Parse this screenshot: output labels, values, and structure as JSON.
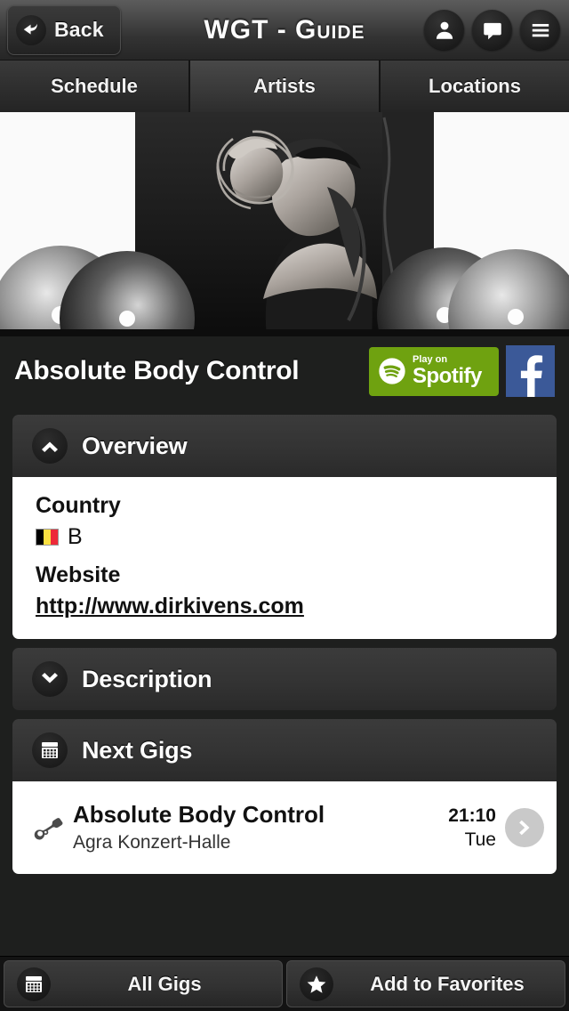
{
  "header": {
    "back_label": "Back",
    "title": "WGT - Guide",
    "icons": [
      "user-icon",
      "chat-icon",
      "menu-icon"
    ]
  },
  "tabs": [
    {
      "label": "Schedule",
      "active": false
    },
    {
      "label": "Artists",
      "active": true
    },
    {
      "label": "Locations",
      "active": false
    }
  ],
  "hero": {
    "alt": "Black and white band photo with vinyl records"
  },
  "artist": {
    "name": "Absolute Body Control",
    "spotify": {
      "line1": "Play on",
      "line2": "Spotify",
      "color": "#6fa210"
    },
    "facebook": {
      "glyph": "f",
      "color": "#3b5998"
    }
  },
  "overview": {
    "title": "Overview",
    "expanded": true,
    "country_label": "Country",
    "country_value": "B",
    "country_flag": [
      "#000000",
      "#fae042",
      "#ed2939"
    ],
    "website_label": "Website",
    "website_url": "http://www.dirkivens.com"
  },
  "description": {
    "title": "Description",
    "expanded": false
  },
  "next_gigs": {
    "title": "Next Gigs",
    "rows": [
      {
        "title": "Absolute Body Control",
        "venue": "Agra Konzert-Halle",
        "time": "21:10",
        "day": "Tue"
      }
    ]
  },
  "bottom_bar": {
    "all_gigs": "All Gigs",
    "add_favorites": "Add to Favorites"
  }
}
